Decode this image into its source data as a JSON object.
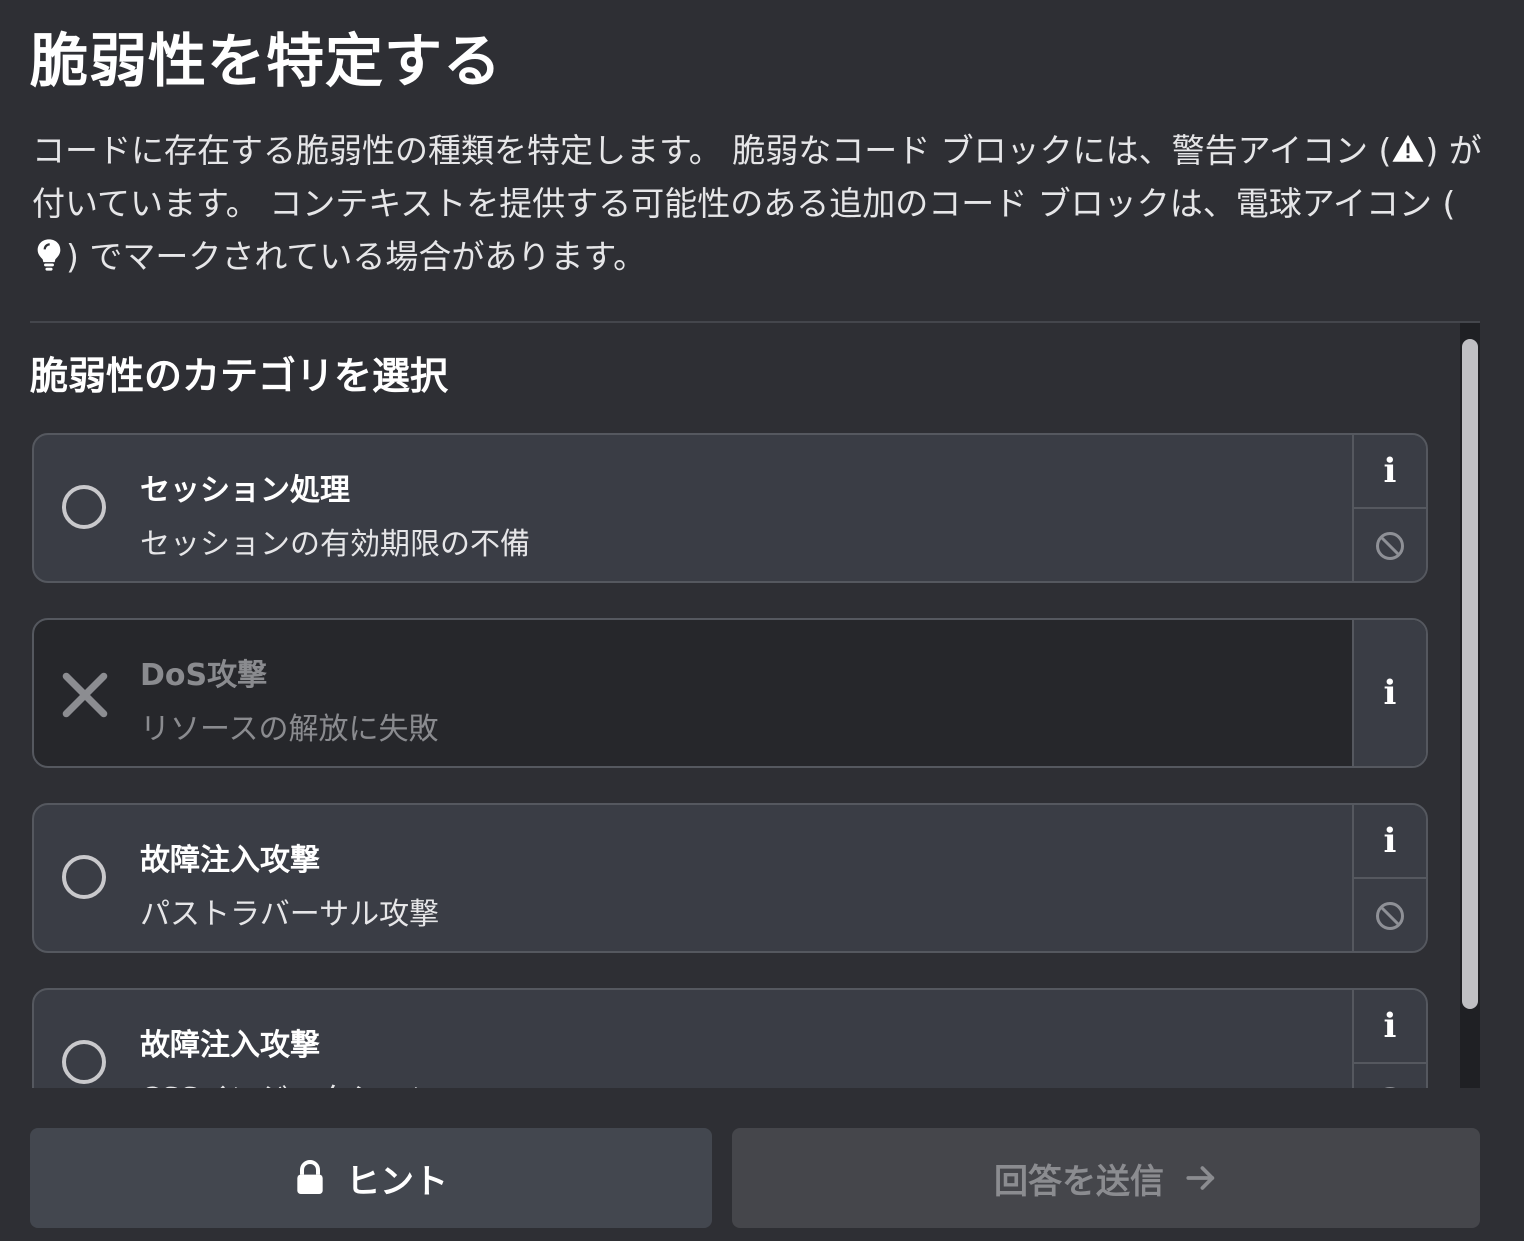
{
  "page": {
    "title": "脆弱性を特定する",
    "description": {
      "part1": "コードに存在する脆弱性の種類を特定します。 脆弱なコード ブロックには、警告アイコン (",
      "part2": ") が付いています。 コンテキストを提供する可能性のある追加のコード ブロックは、電球アイコン (",
      "part3": ") でマークされている場合があります。"
    }
  },
  "section": {
    "title": "脆弱性のカテゴリを選択"
  },
  "options": [
    {
      "title": "セッション処理",
      "subtitle": "セッションの有効期限の不備",
      "state": "selectable"
    },
    {
      "title": "DoS攻撃",
      "subtitle": "リソースの解放に失敗",
      "state": "eliminated"
    },
    {
      "title": "故障注入攻撃",
      "subtitle": "パストラバーサル攻撃",
      "state": "selectable"
    },
    {
      "title": "故障注入攻撃",
      "subtitle": "CSSインジェクション",
      "state": "selectable"
    }
  ],
  "icons": {
    "info": "i",
    "warning": "warning-icon",
    "lightbulb": "lightbulb-icon",
    "eliminate": "ban-icon",
    "lock": "lock-icon",
    "arrow": "arrow-right-icon"
  },
  "buttons": {
    "hint_label": "ヒント",
    "submit_label": "回答を送信"
  },
  "colors": {
    "background": "#2e2f34",
    "card": "#3a3d45",
    "card_disabled": "#26272b",
    "border": "#55585f",
    "hint_button": "#43474f",
    "submit_button_disabled": "#45464b"
  }
}
